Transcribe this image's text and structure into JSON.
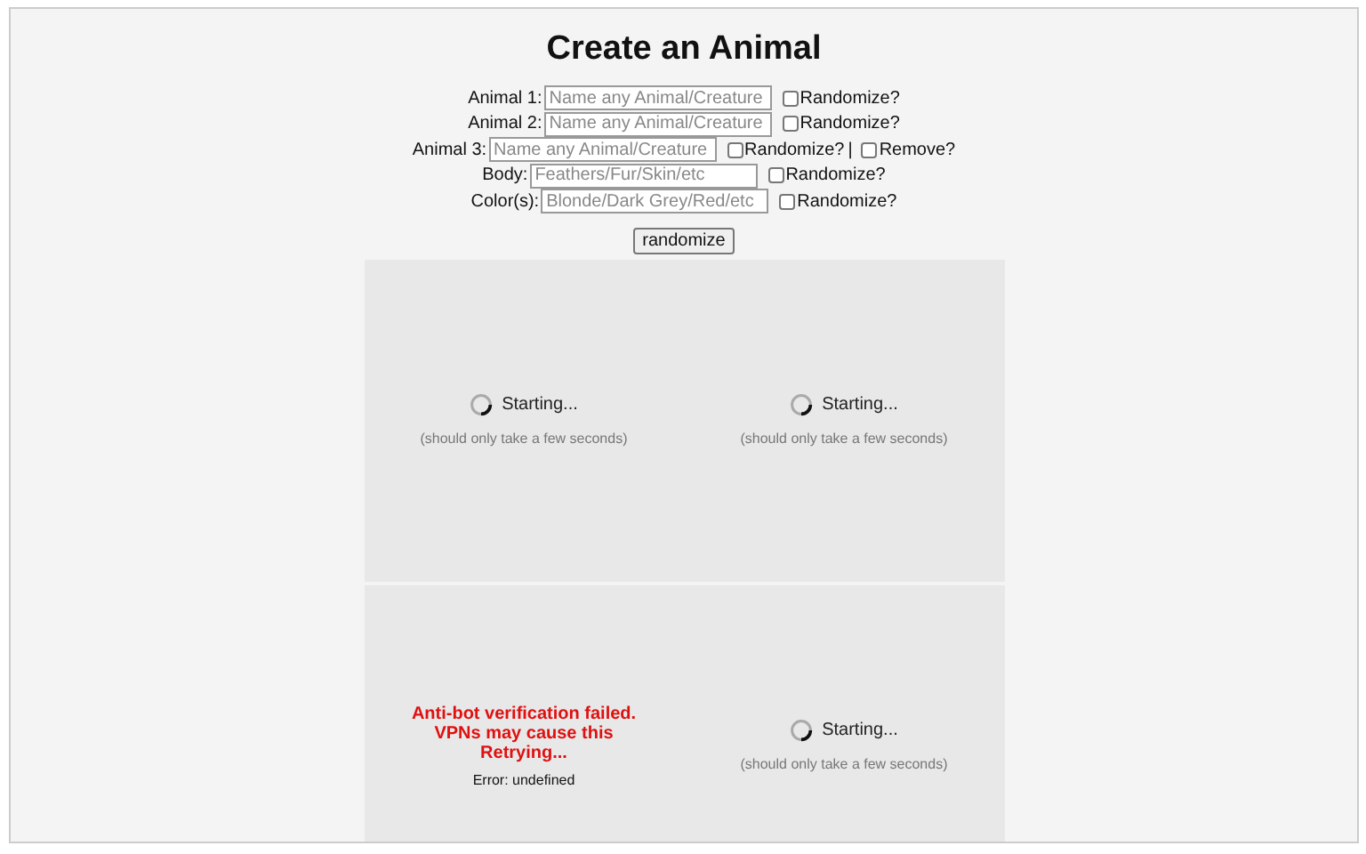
{
  "title": "Create an Animal",
  "fields": [
    {
      "label": "Animal 1:",
      "placeholder": "Name any Animal/Creature",
      "options": [
        {
          "kind": "checkbox",
          "label": "Randomize?",
          "checked": false
        }
      ]
    },
    {
      "label": "Animal 2:",
      "placeholder": "Name any Animal/Creature",
      "options": [
        {
          "kind": "checkbox",
          "label": "Randomize?",
          "checked": false
        }
      ]
    },
    {
      "label": "Animal 3:",
      "placeholder": "Name any Animal/Creature",
      "options": [
        {
          "kind": "checkbox",
          "label": "Randomize?",
          "checked": false
        },
        {
          "kind": "separator",
          "text": "|"
        },
        {
          "kind": "checkbox",
          "label": "Remove?",
          "checked": false
        }
      ]
    },
    {
      "label": "Body:",
      "placeholder": "Feathers/Fur/Skin/etc",
      "options": [
        {
          "kind": "checkbox",
          "label": "Randomize?",
          "checked": false
        }
      ]
    },
    {
      "label": "Color(s):",
      "placeholder": "Blonde/Dark Grey/Red/etc",
      "options": [
        {
          "kind": "checkbox",
          "label": "Randomize?",
          "checked": false
        }
      ]
    }
  ],
  "button": "randomize",
  "results": [
    {
      "kind": "loading",
      "status": "Starting...",
      "note": "(should only take a few seconds)"
    },
    {
      "kind": "loading",
      "status": "Starting...",
      "note": "(should only take a few seconds)"
    },
    {
      "kind": "error",
      "message": "Anti-bot verification failed. VPNs may cause this Retrying...",
      "detail": "Error: undefined"
    },
    {
      "kind": "loading",
      "status": "Starting...",
      "note": "(should only take a few seconds)"
    }
  ]
}
